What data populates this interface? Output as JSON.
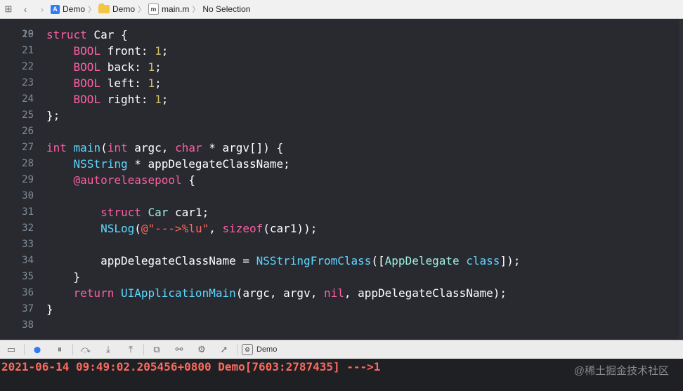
{
  "jump_bar": {
    "grid_icon": "grid-icon",
    "back_icon": "chevron-left-icon",
    "forward_icon": "chevron-right-icon",
    "crumbs": [
      {
        "label": "Demo",
        "icon": "project-icon",
        "icon_glyph": "A"
      },
      {
        "label": "Demo",
        "icon": "folder-icon"
      },
      {
        "label": "main.m",
        "icon": "objc-file-icon",
        "icon_glyph": "m"
      },
      {
        "label": "No Selection"
      }
    ]
  },
  "editor": {
    "first_partial_line": "19",
    "lines": [
      {
        "n": "20",
        "tokens": [
          [
            "kw",
            "struct"
          ],
          [
            "plain",
            " Car {"
          ]
        ]
      },
      {
        "n": "21",
        "tokens": [
          [
            "plain",
            "    "
          ],
          [
            "kw",
            "BOOL"
          ],
          [
            "plain",
            " front: "
          ],
          [
            "num",
            "1"
          ],
          [
            "plain",
            ";"
          ]
        ]
      },
      {
        "n": "22",
        "tokens": [
          [
            "plain",
            "    "
          ],
          [
            "kw",
            "BOOL"
          ],
          [
            "plain",
            " back: "
          ],
          [
            "num",
            "1"
          ],
          [
            "plain",
            ";"
          ]
        ]
      },
      {
        "n": "23",
        "tokens": [
          [
            "plain",
            "    "
          ],
          [
            "kw",
            "BOOL"
          ],
          [
            "plain",
            " left: "
          ],
          [
            "num",
            "1"
          ],
          [
            "plain",
            ";"
          ]
        ]
      },
      {
        "n": "24",
        "tokens": [
          [
            "plain",
            "    "
          ],
          [
            "kw",
            "BOOL"
          ],
          [
            "plain",
            " right: "
          ],
          [
            "num",
            "1"
          ],
          [
            "plain",
            ";"
          ]
        ]
      },
      {
        "n": "25",
        "tokens": [
          [
            "plain",
            "};"
          ]
        ]
      },
      {
        "n": "26",
        "tokens": []
      },
      {
        "n": "27",
        "tokens": [
          [
            "kw",
            "int"
          ],
          [
            "plain",
            " "
          ],
          [
            "type",
            "main"
          ],
          [
            "plain",
            "("
          ],
          [
            "kw",
            "int"
          ],
          [
            "plain",
            " argc, "
          ],
          [
            "kw",
            "char"
          ],
          [
            "plain",
            " * argv[]) {"
          ]
        ]
      },
      {
        "n": "28",
        "tokens": [
          [
            "plain",
            "    "
          ],
          [
            "type",
            "NSString"
          ],
          [
            "plain",
            " * appDelegateClassName;"
          ]
        ]
      },
      {
        "n": "29",
        "tokens": [
          [
            "plain",
            "    "
          ],
          [
            "kw",
            "@autoreleasepool"
          ],
          [
            "plain",
            " {"
          ]
        ]
      },
      {
        "n": "30",
        "tokens": []
      },
      {
        "n": "31",
        "tokens": [
          [
            "plain",
            "        "
          ],
          [
            "kw",
            "struct"
          ],
          [
            "plain",
            " "
          ],
          [
            "cls",
            "Car"
          ],
          [
            "plain",
            " car1;"
          ]
        ]
      },
      {
        "n": "32",
        "tokens": [
          [
            "plain",
            "        "
          ],
          [
            "type",
            "NSLog"
          ],
          [
            "plain",
            "("
          ],
          [
            "str",
            "@\"--->%lu\""
          ],
          [
            "plain",
            ", "
          ],
          [
            "kw",
            "sizeof"
          ],
          [
            "plain",
            "(car1));"
          ]
        ]
      },
      {
        "n": "33",
        "tokens": []
      },
      {
        "n": "34",
        "tokens": [
          [
            "plain",
            "        appDelegateClassName = "
          ],
          [
            "type",
            "NSStringFromClass"
          ],
          [
            "plain",
            "(["
          ],
          [
            "cls",
            "AppDelegate"
          ],
          [
            "plain",
            " "
          ],
          [
            "type",
            "class"
          ],
          [
            "plain",
            "]);"
          ]
        ]
      },
      {
        "n": "35",
        "tokens": [
          [
            "plain",
            "    }"
          ]
        ]
      },
      {
        "n": "36",
        "tokens": [
          [
            "plain",
            "    "
          ],
          [
            "kw",
            "return"
          ],
          [
            "plain",
            " "
          ],
          [
            "type",
            "UIApplicationMain"
          ],
          [
            "plain",
            "(argc, argv, "
          ],
          [
            "kw",
            "nil"
          ],
          [
            "plain",
            ", appDelegateClassName);"
          ]
        ]
      },
      {
        "n": "37",
        "tokens": [
          [
            "plain",
            "}"
          ]
        ]
      },
      {
        "n": "38",
        "tokens": []
      }
    ]
  },
  "debug_bar": {
    "buttons": [
      {
        "name": "hide-debug-area-button",
        "icon": "panel-icon",
        "glyph": "▭"
      },
      {
        "name": "breakpoints-toggle-button",
        "icon": "breakpoint-icon",
        "glyph": "⬤",
        "active": true
      },
      {
        "name": "pause-button",
        "icon": "pause-icon",
        "glyph": "⏸"
      },
      {
        "name": "step-over-button",
        "icon": "step-over-icon",
        "glyph": "⤼"
      },
      {
        "name": "step-into-button",
        "icon": "step-into-icon",
        "glyph": "⤓"
      },
      {
        "name": "step-out-button",
        "icon": "step-out-icon",
        "glyph": "⤒"
      },
      {
        "name": "view-debugger-button",
        "icon": "view-hierarchy-icon",
        "glyph": "⧉"
      },
      {
        "name": "memory-graph-button",
        "icon": "memory-graph-icon",
        "glyph": "⚯"
      },
      {
        "name": "environment-overrides-button",
        "icon": "environment-icon",
        "glyph": "⚙"
      },
      {
        "name": "simulate-location-button",
        "icon": "location-arrow-icon",
        "glyph": "➚"
      }
    ],
    "target_label": "Demo",
    "target_icon": "app-target-icon"
  },
  "console": {
    "output": "2021-06-14 09:49:02.205456+0800 Demo[7603:2787435] --->1",
    "watermark": "@稀土掘金技术社区"
  },
  "colors": {
    "editor_bg": "#292a30",
    "keyword": "#fc5fa3",
    "number": "#d0bf69",
    "type": "#5dd8ff",
    "class": "#9ef1dd",
    "string": "#fc6a5d",
    "line_number": "#7f8c98",
    "console_text": "#fc6a5d"
  }
}
